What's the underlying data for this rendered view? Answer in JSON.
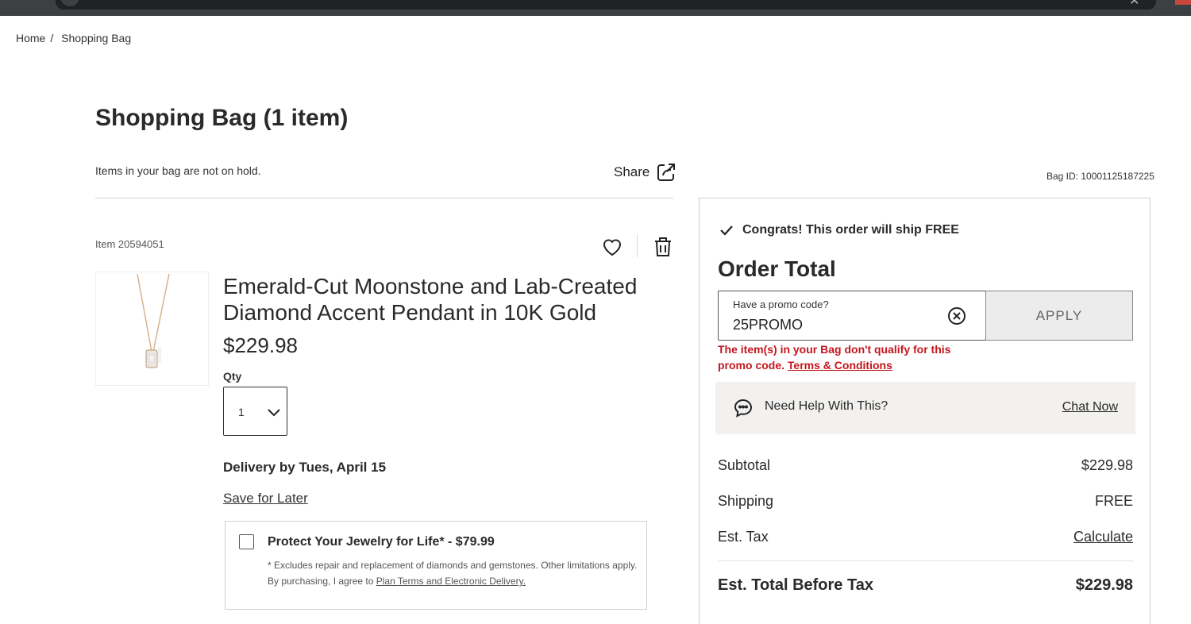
{
  "breadcrumb": {
    "home": "Home",
    "separator": "/",
    "current": "Shopping Bag"
  },
  "page": {
    "title": "Shopping Bag  (1 item)",
    "hold_note": "Items in your bag are not on hold.",
    "share_label": "Share",
    "bag_id": "Bag ID: 10001125187225"
  },
  "item": {
    "item_number": "Item 20594051",
    "name": "Emerald-Cut Moonstone and Lab-Created Diamond Accent Pendant in 10K Gold",
    "price": "$229.98",
    "qty_label": "Qty",
    "qty_value": "1",
    "delivery": "Delivery by Tues, April 15",
    "save_for_later": "Save for Later",
    "icons": {
      "favorite": "heart-icon",
      "remove": "trash-icon",
      "qty": "chevron-down-icon"
    }
  },
  "protection": {
    "title": "Protect Your Jewelry for Life* - $79.99",
    "note_line1": "* Excludes repair and replacement of diamonds and gemstones. Other limitations apply.",
    "note_line2_prefix": "By purchasing, I agree to ",
    "note_link": "Plan Terms and Electronic Delivery."
  },
  "summary": {
    "ship_free": "Congrats! This order will ship FREE",
    "order_total_title": "Order Total",
    "promo": {
      "label": "Have a promo code?",
      "value": "25PROMO",
      "apply": "APPLY",
      "error_text": "The item(s) in your Bag don't qualify for this promo code. ",
      "error_link": "Terms & Conditions"
    },
    "help": {
      "text": "Need Help With This?",
      "chat": "Chat Now"
    },
    "subtotal_label": "Subtotal",
    "subtotal_value": "$229.98",
    "shipping_label": "Shipping",
    "shipping_value": "FREE",
    "tax_label": "Est. Tax",
    "tax_value": "Calculate",
    "total_label": "Est. Total Before Tax",
    "total_value": "$229.98"
  },
  "colors": {
    "error": "#c4161c",
    "help_bg": "#f2f1ef",
    "apply_bg": "#ececec"
  }
}
